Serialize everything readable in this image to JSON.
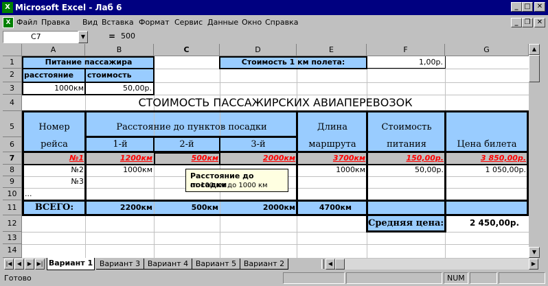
{
  "window": {
    "title": "Microsoft Excel - Лаб 6"
  },
  "menu": [
    "Файл",
    "Правка",
    "Вид",
    "Вставка",
    "Формат",
    "Сервис",
    "Данные",
    "Окно",
    "Справка"
  ],
  "formula": {
    "name_box": "C7",
    "equals": "=",
    "value": "500"
  },
  "columns": [
    "A",
    "B",
    "C",
    "D",
    "E",
    "F",
    "G"
  ],
  "rows": [
    "1",
    "2",
    "3",
    "4",
    "5",
    "6",
    "7",
    "8",
    "9",
    "10",
    "11",
    "12",
    "13",
    "14"
  ],
  "cells": {
    "a1": "Питание пассажира",
    "a2": "расстояние",
    "b2": "стоимость",
    "a3": "1000км",
    "b3": "50,00р.",
    "d1": "Стоимость 1 км полета:",
    "f1": "1,00р.",
    "title": "СТОИМОСТЬ ПАССАЖИРСКИХ АВИАПЕРЕВОЗОК",
    "h_num1": "Номер",
    "h_num2": "рейса",
    "h_dist": "Расстояние до пунктов посадки",
    "h_1": "1-й",
    "h_2": "2-й",
    "h_3": "3-й",
    "h_len1": "Длина",
    "h_len2": "маршрута",
    "h_cost1": "Стоимость",
    "h_cost2": "питания",
    "h_price": "Цена билета",
    "r7a": "№1",
    "r7b": "1200км",
    "r7c": "500км",
    "r7d": "2000км",
    "r7e": "3700км",
    "r7f": "150,00р.",
    "r7g": "3 850,00р.",
    "r8a": "№2",
    "r8b": "1000км",
    "r8e": "1000км",
    "r8f": "50,00р.",
    "r8g": "1 050,00р.",
    "r9a": "№3",
    "r10a": "...",
    "total": "ВСЕГО:",
    "tb": "2200км",
    "tc": "500км",
    "td": "2000км",
    "te": "4700км",
    "avg_label": "Средняя цена:",
    "avg_value": "2 450,00р."
  },
  "tooltip": {
    "title": "Расстояние до посадки",
    "text": "от 100 км до 1000 км"
  },
  "tabs": [
    "Вариант 1",
    "Вариант 3",
    "Вариант 4",
    "Вариант 5",
    "Вариант 2"
  ],
  "status": {
    "ready": "Готово",
    "num": "NUM"
  },
  "colors": {
    "header_fill": "#99ccff",
    "title_bar": "#000080",
    "highlight": "#ff0000"
  }
}
